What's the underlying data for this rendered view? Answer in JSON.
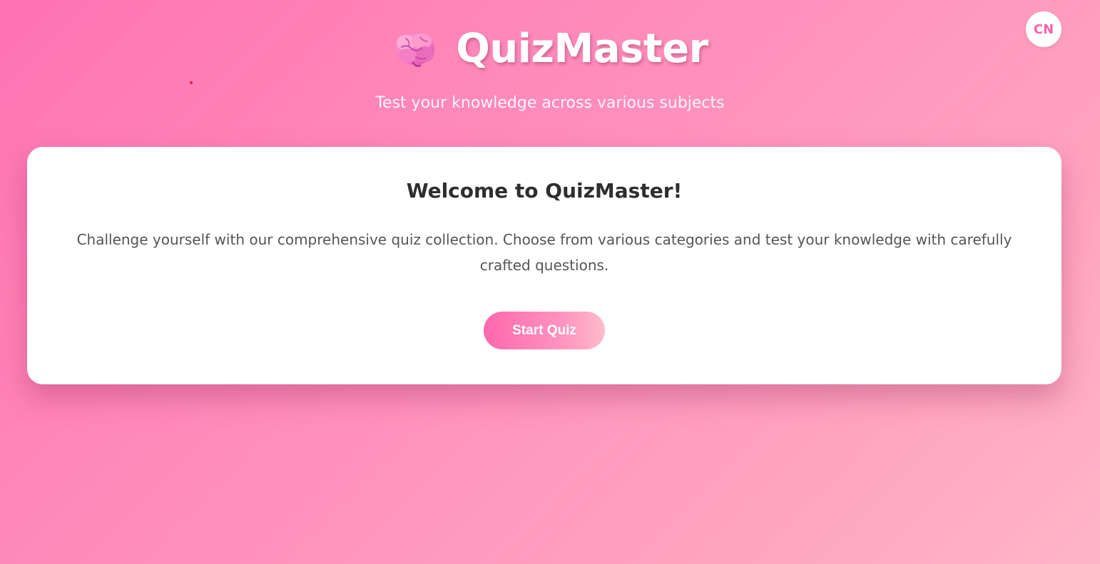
{
  "header": {
    "title": "QuizMaster",
    "subtitle": "Test your knowledge across various subjects",
    "icon": "brain-icon"
  },
  "language_toggle": {
    "label": "CN"
  },
  "welcome_card": {
    "heading": "Welcome to QuizMaster!",
    "description": "Challenge yourself with our comprehensive quiz collection. Choose from various categories and test your knowledge with carefully crafted questions.",
    "start_button_label": "Start Quiz"
  },
  "colors": {
    "background_start": "#ff73b3",
    "background_end": "#ffb5c8",
    "accent": "#ff5fa8",
    "card_background": "#ffffff",
    "heading_text": "#2e2e2e",
    "body_text": "#555555"
  }
}
